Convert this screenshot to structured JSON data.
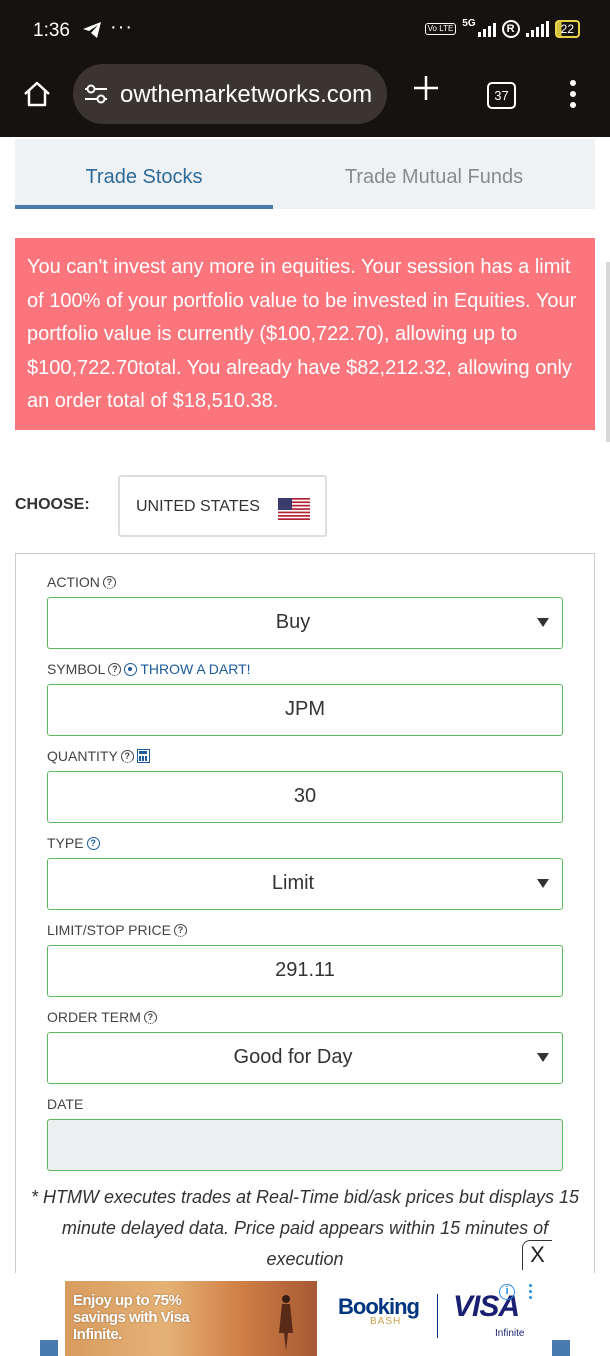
{
  "status_bar": {
    "time": "1:36",
    "more": "···",
    "volte": "Vo LTE",
    "network": "5G",
    "roaming": "R",
    "battery": "22"
  },
  "browser": {
    "url": "owthemarketworks.com",
    "tab_count": "37"
  },
  "tabs": [
    {
      "label": "Trade Stocks",
      "active": true
    },
    {
      "label": "Trade Mutual Funds",
      "active": false
    }
  ],
  "alert": {
    "message": "You can't invest any more in equities. Your session has a limit of 100% of your portfolio value to be invested in Equities. Your portfolio value is currently ($100,722.70), allowing up to $100,722.70total. You already have $82,212.32, allowing only an order total of $18,510.38.",
    "color": "#fb767c"
  },
  "choose": {
    "label": "CHOOSE:",
    "country": "UNITED STATES"
  },
  "form": {
    "action": {
      "label": "ACTION",
      "value": "Buy"
    },
    "symbol": {
      "label": "SYMBOL",
      "dart_label": "THROW A DART!",
      "value": "JPM"
    },
    "quantity": {
      "label": "QUANTITY",
      "value": "30"
    },
    "type": {
      "label": "TYPE",
      "value": "Limit"
    },
    "limit_price": {
      "label": "LIMIT/STOP PRICE",
      "value": "291.11"
    },
    "order_term": {
      "label": "ORDER TERM",
      "value": "Good for Day"
    },
    "date": {
      "label": "DATE",
      "value": ""
    }
  },
  "disclaimer": "* HTMW executes trades at Real-Time bid/ask prices but displays 15 minute delayed data. Price paid appears within 15 minutes of execution",
  "ad": {
    "close": "X",
    "headline": "Enjoy up to 75% savings with Visa Infinite.",
    "brand1": "Booking",
    "brand1_sub": "BASH",
    "brand2": "VISA",
    "brand2_sub": "Infinite",
    "info": "i"
  },
  "colors": {
    "accent": "#4a7bb0",
    "field_border": "#5cb85c",
    "link": "#1c5a9c"
  }
}
